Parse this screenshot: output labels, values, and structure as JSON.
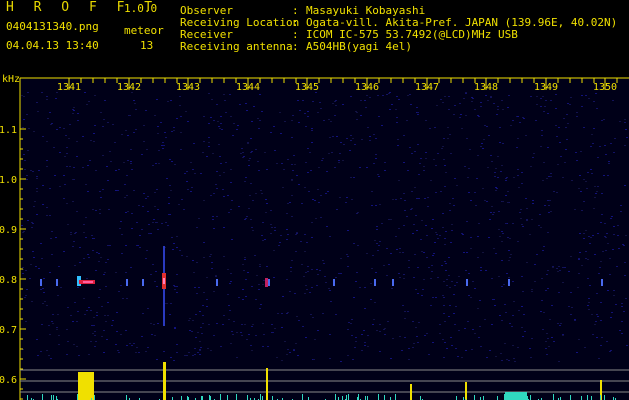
{
  "app": {
    "name": "H R O F F T",
    "version": "1.0.0"
  },
  "file": {
    "name": "0404131340.png",
    "datetime": "04.04.13 13:40"
  },
  "meteor": {
    "label": "meteor",
    "count": "13"
  },
  "info": [
    {
      "label": "Observer",
      "value": "Masayuki Kobayashi"
    },
    {
      "label": "Receiving Location",
      "value": "Ogata-vill. Akita-Pref. JAPAN (139.96E, 40.02N)"
    },
    {
      "label": "Receiver",
      "value": "ICOM IC-575 53.7492(@LCD)MHz USB"
    },
    {
      "label": "Receiving antenna",
      "value": "A504HB(yagi 4el)"
    }
  ],
  "chart_data": {
    "type": "heatmap",
    "title": "",
    "ylabel": "kHz",
    "x_ticks": [
      "1341",
      "1342",
      "1343",
      "1344",
      "1345",
      "1346",
      "1347",
      "1348",
      "1349",
      "1350"
    ],
    "y_ticks": [
      "1.1",
      "1.0",
      "0.9",
      "0.8",
      "0.7",
      "0.6"
    ],
    "ylim": [
      0.58,
      1.19
    ],
    "detections": [
      {
        "time": "1341.5",
        "freq_khz": 0.795,
        "strength": "strong"
      },
      {
        "time": "1342.8",
        "freq_khz": 0.79,
        "strength": "strong"
      },
      {
        "time": "1344.4",
        "freq_khz": 0.79,
        "strength": "medium"
      }
    ],
    "colors": {
      "background": "#000018",
      "signal_hot": "#e02020",
      "signal_cold": "#2020d0",
      "level_bar": "#f0e000"
    }
  }
}
